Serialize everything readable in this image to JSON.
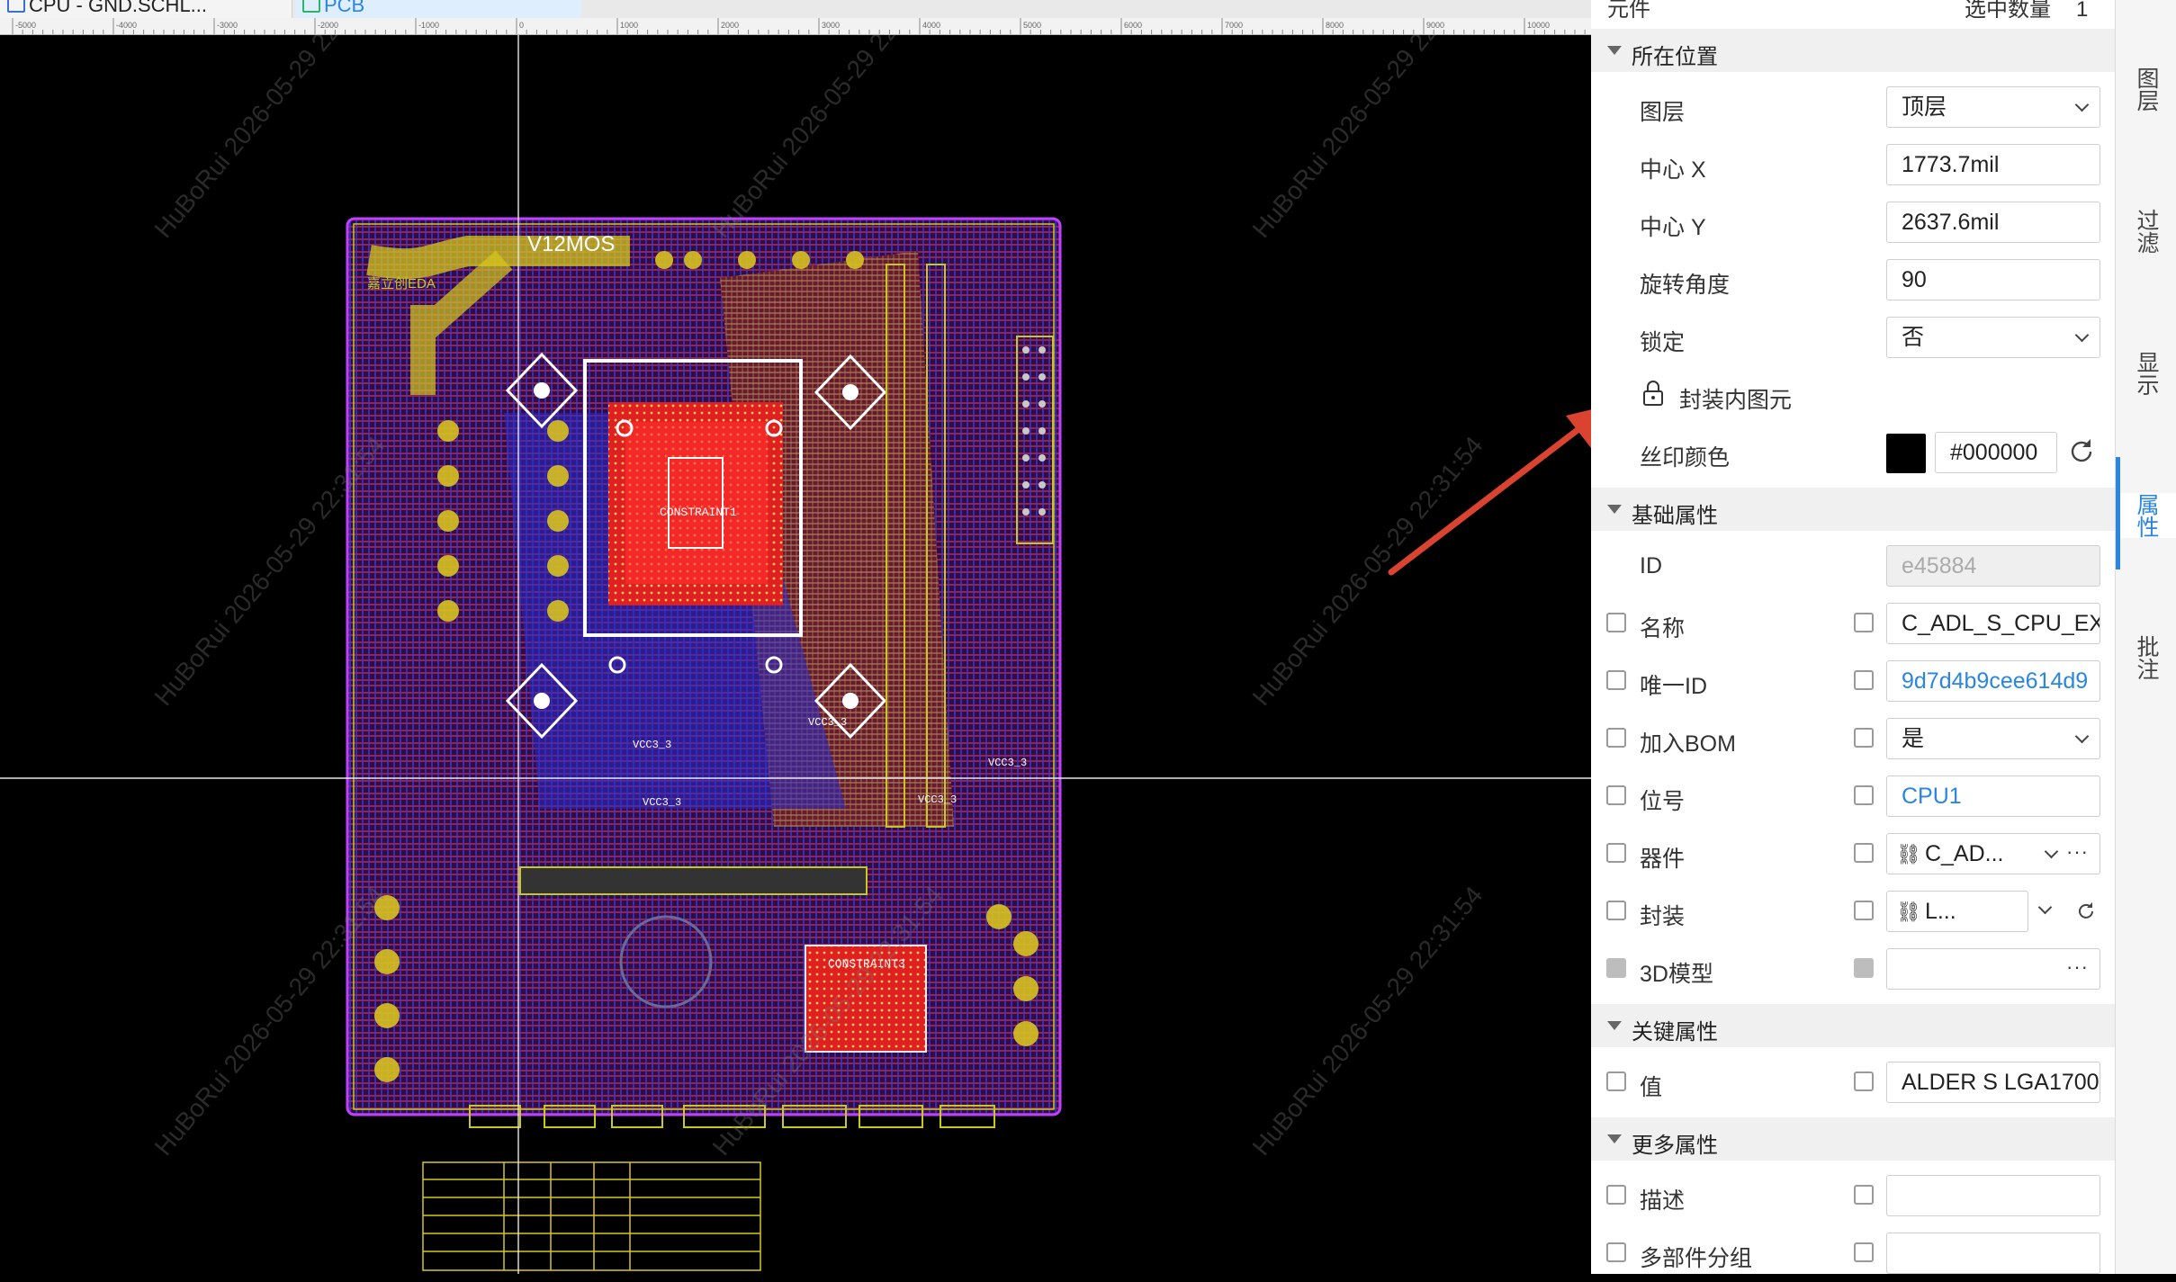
{
  "tabs": [
    {
      "label": "CPU - GND.SCHL..."
    },
    {
      "label": "PCB"
    }
  ],
  "ruler": {
    "ticks": [
      "-5000",
      "-4000",
      "-3000",
      "-2000",
      "-1000",
      "0",
      "1000",
      "2000",
      "3000",
      "4000",
      "5000",
      "6000",
      "7000",
      "8000",
      "9000",
      "10000"
    ]
  },
  "board": {
    "labels": [
      "V12MOS",
      "CONSTRAINT1",
      "CONSTRAINT3",
      "VCC3_3",
      "VCC3_3",
      "VCC3_3",
      "VCC3_3",
      "VCC3_3",
      "嘉立创EDA"
    ]
  },
  "watermark": {
    "text": "HuBoRui 2026-05-29 22:31:54"
  },
  "panel": {
    "header": {
      "label": "元件",
      "count_label": "选中数量",
      "count": "1"
    },
    "sections": {
      "location": "所在位置",
      "basic": "基础属性",
      "key": "关键属性",
      "more": "更多属性"
    },
    "location": {
      "layer_label": "图层",
      "layer_value": "顶层",
      "cx_label": "中心 X",
      "cx_value": "1773.7mil",
      "cy_label": "中心 Y",
      "cy_value": "2637.6mil",
      "rot_label": "旋转角度",
      "rot_value": "90",
      "lock_label": "锁定",
      "lock_value": "否",
      "inner_label": "封装内图元",
      "silk_label": "丝印颜色",
      "silk_value": "#000000",
      "silk_color": "#000000"
    },
    "basic": {
      "id_label": "ID",
      "id_value": "e45884",
      "name_label": "名称",
      "name_value": "C_ADL_S_CPU_EXT",
      "uid_label": "唯一ID",
      "uid_value": "9d7d4b9cee614d9",
      "bom_label": "加入BOM",
      "bom_value": "是",
      "designator_label": "位号",
      "designator_value": "CPU1",
      "device_label": "器件",
      "device_value": "C_AD...",
      "footprint_label": "封装",
      "footprint_value": "L...",
      "model_label": "3D模型",
      "model_value": ""
    },
    "key": {
      "value_label": "值",
      "value_value": "ALDER S LGA1700"
    },
    "more": {
      "desc_label": "描述",
      "desc_value": "",
      "group_label": "多部件分组",
      "group_value": ""
    }
  },
  "side_tabs": [
    "图层",
    "过滤",
    "显示",
    "属性",
    "批注"
  ],
  "colors": {
    "accent": "#2a86e0",
    "arrow": "#d9432f",
    "board_bg": "#000000"
  }
}
